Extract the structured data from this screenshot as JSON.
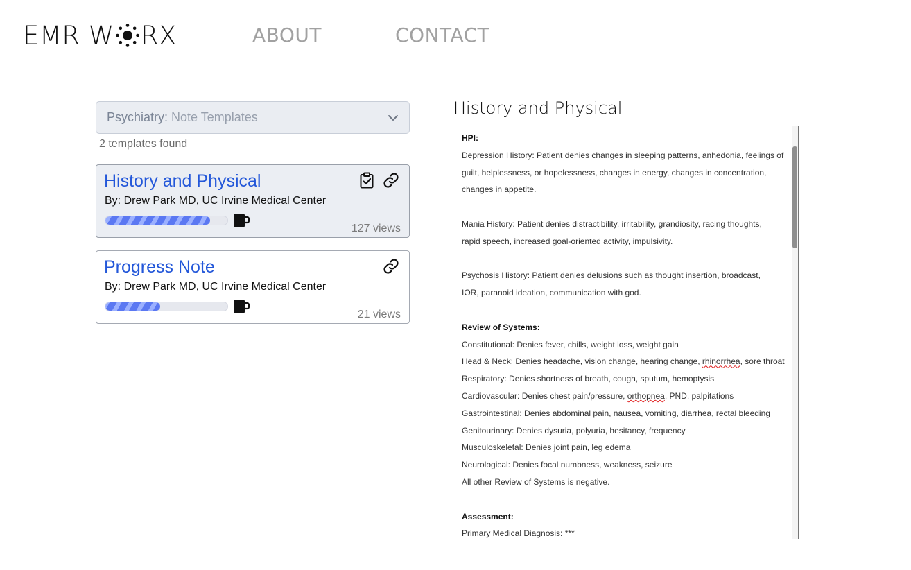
{
  "header": {
    "logo_pre": "EMR W",
    "logo_post": "RX",
    "nav": [
      {
        "label": "ABOUT"
      },
      {
        "label": "CONTACT"
      }
    ]
  },
  "filter": {
    "specialty": "Psychiatry:",
    "selected": "Note Templates"
  },
  "results_count": "2 templates found",
  "templates": [
    {
      "title": "History and Physical",
      "author": "By: Drew Park MD, UC Irvine Medical Center",
      "views": "127 views",
      "popularity": 0.86,
      "selected": true,
      "icons": [
        "clipboard-check-icon",
        "link-icon"
      ]
    },
    {
      "title": "Progress Note",
      "author": "By: Drew Park MD, UC Irvine Medical Center",
      "views": "21 views",
      "popularity": 0.45,
      "selected": false,
      "icons": [
        "link-icon"
      ]
    }
  ],
  "preview": {
    "title": "History and Physical",
    "lines": [
      {
        "text": "HPI:",
        "bold": true
      },
      {
        "text": "Depression History: Patient denies changes in sleeping patterns, anhedonia, feelings of"
      },
      {
        "text": "guilt, helplessness, or hopelessness, changes in energy, changes in concentration,"
      },
      {
        "text": "changes in appetite."
      },
      {
        "text": ""
      },
      {
        "text": "Mania History: Patient denies distractibility, irritability, grandiosity, racing thoughts,"
      },
      {
        "text": "rapid speech, increased goal-oriented activity, impulsivity."
      },
      {
        "text": ""
      },
      {
        "text": "Psychosis History: Patient denies delusions such as thought insertion, broadcast,"
      },
      {
        "text": "IOR, paranoid ideation, communication with god."
      },
      {
        "text": ""
      },
      {
        "text": "Review of Systems:",
        "bold": true
      },
      {
        "text": "Constitutional: Denies fever, chills, weight loss, weight gain"
      },
      {
        "text": "Head & Neck: Denies headache, vision change, hearing change, rhinorrhea, sore throat",
        "misspelled": "rhinorrhea"
      },
      {
        "text": "Respiratory: Denies shortness of breath, cough, sputum, hemoptysis"
      },
      {
        "text": "Cardiovascular: Denies chest pain/pressure, orthopnea, PND, palpitations",
        "misspelled": "orthopnea"
      },
      {
        "text": "Gastrointestinal: Denies abdominal pain, nausea, vomiting, diarrhea, rectal bleeding"
      },
      {
        "text": "Genitourinary: Denies dysuria, polyuria, hesitancy, frequency"
      },
      {
        "text": "Musculoskeletal: Denies joint pain, leg edema"
      },
      {
        "text": "Neurological: Denies focal numbness, weakness, seizure"
      },
      {
        "text": "All other Review of Systems is negative."
      },
      {
        "text": ""
      },
      {
        "text": "Assessment:",
        "bold": true
      },
      {
        "text": "Primary Medical Diagnosis: ***"
      }
    ]
  },
  "colors": {
    "accent": "#2357d9",
    "card_selected_bg": "#ebeef3",
    "bar_fill": "#5b78f2",
    "nav": "#a1a1a1"
  }
}
